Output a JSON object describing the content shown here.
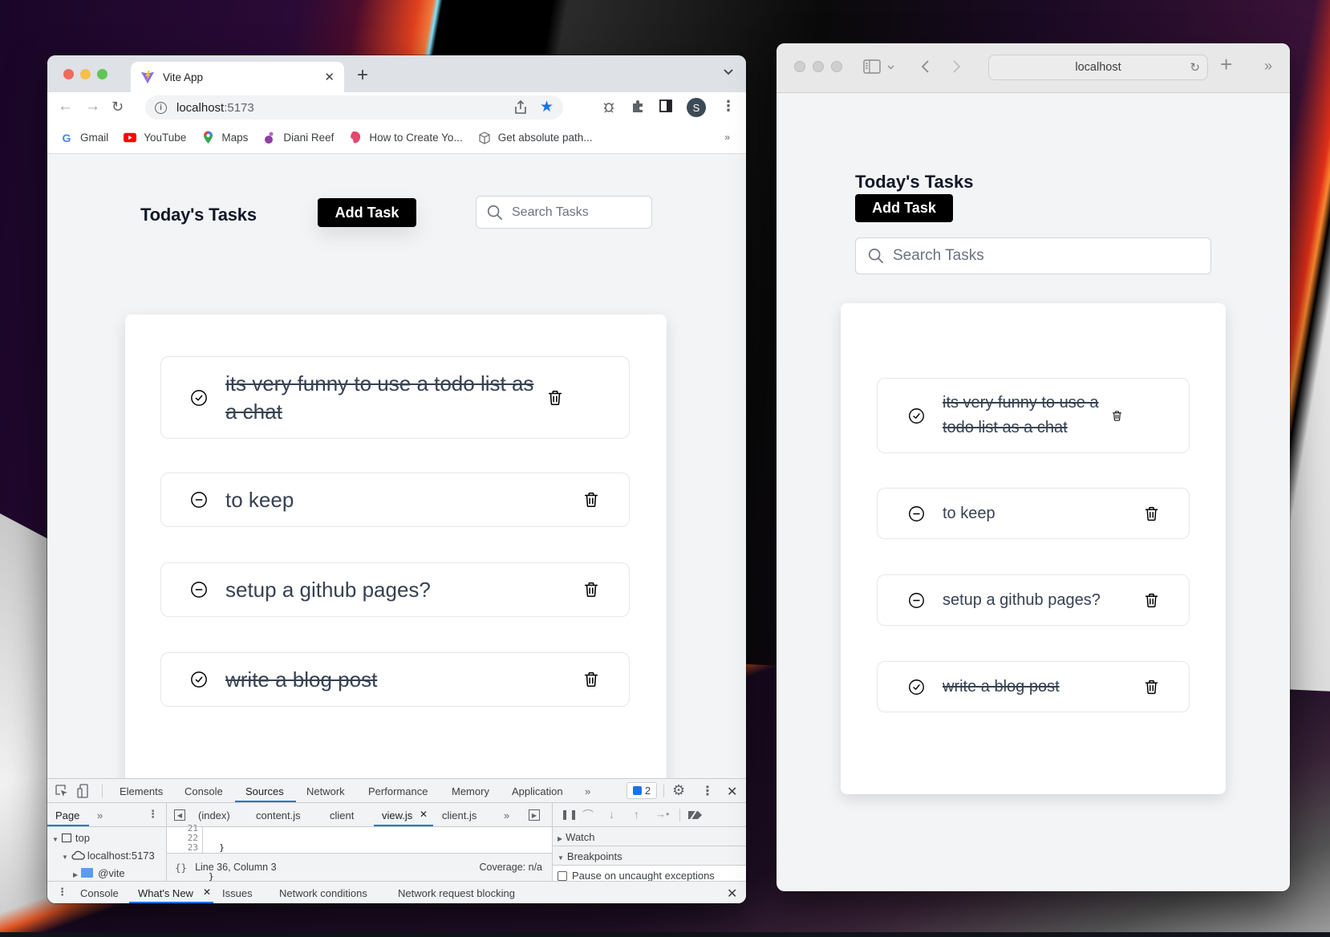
{
  "chrome": {
    "tab_title": "Vite App",
    "tab_close": "✕",
    "new_tab": "+",
    "tab_menu": "⌄",
    "url_host": "localhost",
    "url_port": ":5173",
    "avatar_letter": "S",
    "bookmarks": [
      {
        "label": "Gmail",
        "icon": "google-icon"
      },
      {
        "label": "YouTube",
        "icon": "youtube-icon"
      },
      {
        "label": "Maps",
        "icon": "maps-icon"
      },
      {
        "label": "Diani Reef",
        "icon": "diani-reef-icon"
      },
      {
        "label": "How to Create Yo...",
        "icon": "bookmark-favicon"
      },
      {
        "label": "Get absolute path...",
        "icon": "cube-icon"
      }
    ],
    "bookmarks_more": "»"
  },
  "app": {
    "title": "Today's Tasks",
    "add_task_label": "Add Task",
    "search_placeholder": "Search Tasks",
    "tasks": [
      {
        "text": "its very funny to use a todo list as a chat",
        "completed": true
      },
      {
        "text": "to keep",
        "completed": false
      },
      {
        "text": "setup a github pages?",
        "completed": false
      },
      {
        "text": "write a blog post",
        "completed": true
      }
    ]
  },
  "devtools": {
    "main_tabs": [
      "Elements",
      "Console",
      "Sources",
      "Network",
      "Performance",
      "Memory",
      "Application"
    ],
    "active_tab": "Sources",
    "more": "»",
    "issues_count": "2",
    "navigator_tab": "Page",
    "file_tabs": [
      "(index)",
      "content.js",
      "client",
      "view.js",
      "client.js"
    ],
    "active_file": "view.js",
    "tree": [
      {
        "label": "top",
        "depth": 0
      },
      {
        "label": "localhost:5173",
        "depth": 1
      },
      {
        "label": "@vite",
        "depth": 2
      }
    ],
    "code_lines": [
      {
        "num": "21",
        "code": "  }"
      },
      {
        "num": "22",
        "code": "}"
      },
      {
        "num": "23",
        "code": ""
      }
    ],
    "cursor_position": "Line 36, Column 3",
    "coverage": "Coverage: n/a",
    "sections": [
      "Watch",
      "Breakpoints"
    ],
    "pause_uncaught": "Pause on uncaught exceptions",
    "drawer_tabs": [
      "Console",
      "What's New",
      "Issues",
      "Network conditions",
      "Network request blocking"
    ],
    "active_drawer_tab": "What's New"
  },
  "safari": {
    "url": "localhost"
  }
}
